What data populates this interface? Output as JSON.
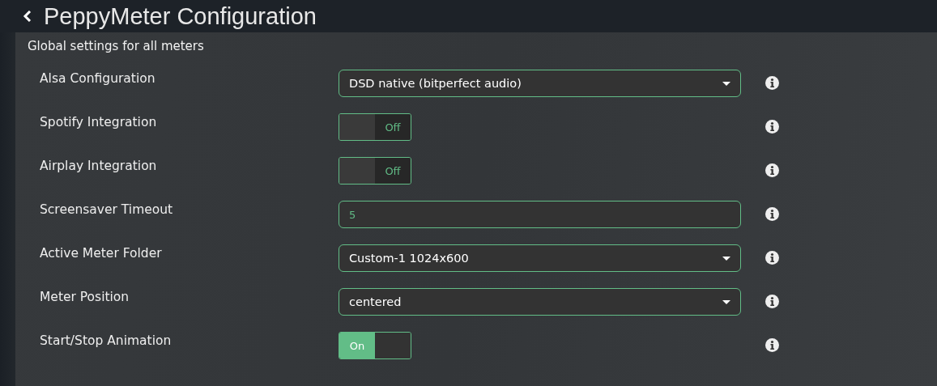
{
  "header": {
    "title": "PeppyMeter Configuration"
  },
  "section": {
    "heading": "Global settings for all meters",
    "settings": [
      {
        "kind": "select",
        "label": "Alsa Configuration",
        "value": "DSD native (bitperfect audio)"
      },
      {
        "kind": "toggle",
        "label": "Spotify Integration",
        "on": false,
        "state_text": "Off"
      },
      {
        "kind": "toggle",
        "label": "Airplay Integration",
        "on": false,
        "state_text": "Off"
      },
      {
        "kind": "text",
        "label": "Screensaver Timeout",
        "value": "5"
      },
      {
        "kind": "select",
        "label": "Active Meter Folder",
        "value": "Custom-1 1024x600"
      },
      {
        "kind": "select",
        "label": "Meter Position",
        "value": "centered"
      },
      {
        "kind": "toggle",
        "label": "Start/Stop Animation",
        "on": true,
        "state_text": "On"
      }
    ]
  }
}
